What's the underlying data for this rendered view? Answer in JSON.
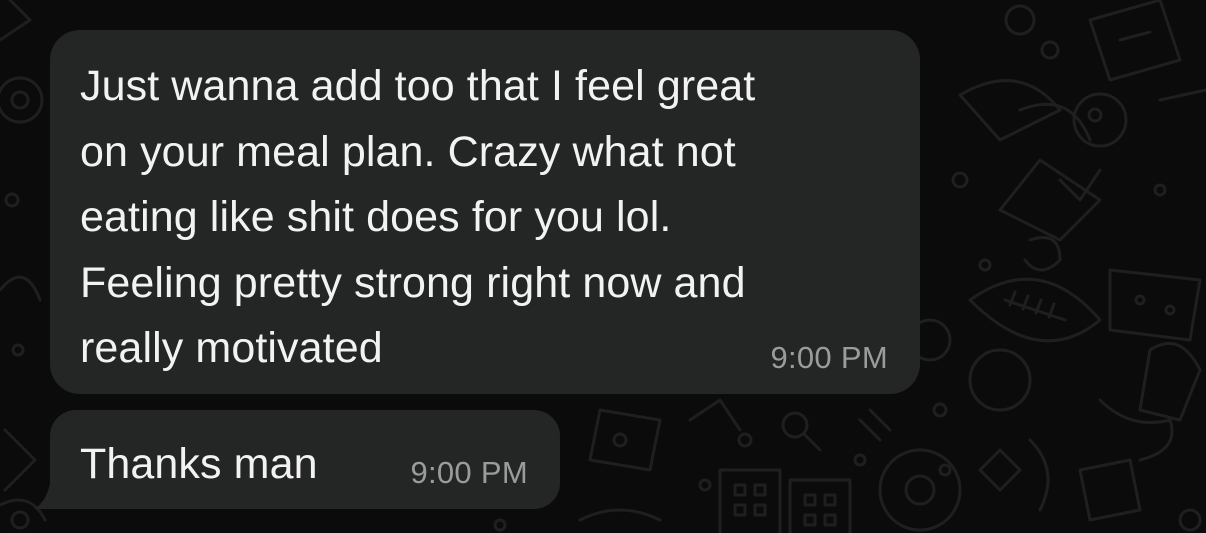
{
  "theme": {
    "background": "#0b0b0b",
    "bubble_color": "#242625",
    "text_color": "#f2f2f2",
    "time_color": "#9a9c9b",
    "wallpaper_doodle_color": "#1c1c1c"
  },
  "messages": [
    {
      "direction": "incoming",
      "text": "Just wanna add too that I feel great\non your meal plan. Crazy what not\neating like shit does for you lol.\nFeeling pretty strong right now and\nreally motivated",
      "time": "9:00 PM"
    },
    {
      "direction": "incoming",
      "text": "Thanks man",
      "time": "9:00 PM"
    }
  ]
}
